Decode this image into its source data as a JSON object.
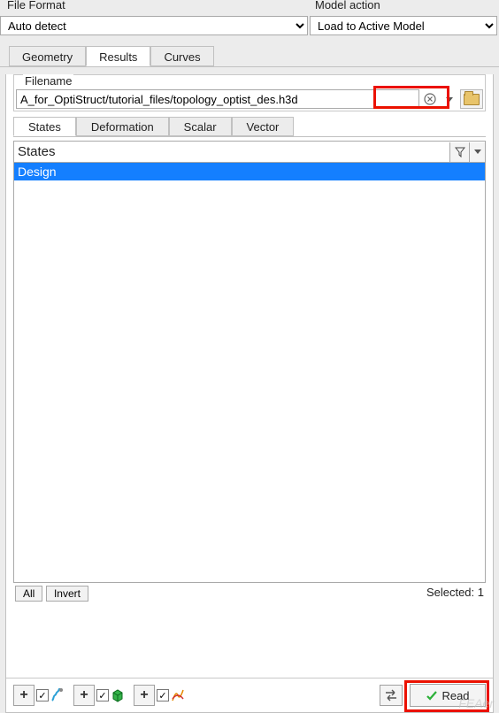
{
  "top": {
    "file_format": {
      "label": "File Format",
      "value": "Auto detect"
    },
    "model_action": {
      "label": "Model action",
      "value": "Load to Active Model"
    }
  },
  "main_tabs": {
    "geometry": "Geometry",
    "results": "Results",
    "curves": "Curves",
    "active": "results"
  },
  "filename": {
    "label": "Filename",
    "value": "A_for_OptiStruct/tutorial_files/topology_optist_des.h3d"
  },
  "sub_tabs": {
    "states": "States",
    "deformation": "Deformation",
    "scalar": "Scalar",
    "vector": "Vector",
    "active": "states"
  },
  "states": {
    "header": "States",
    "items": [
      "Design"
    ]
  },
  "list_controls": {
    "all": "All",
    "invert": "Invert",
    "selected_label": "Selected:",
    "selected_count": 1
  },
  "bottom": {
    "read": "Read"
  },
  "watermark": "FEAer"
}
